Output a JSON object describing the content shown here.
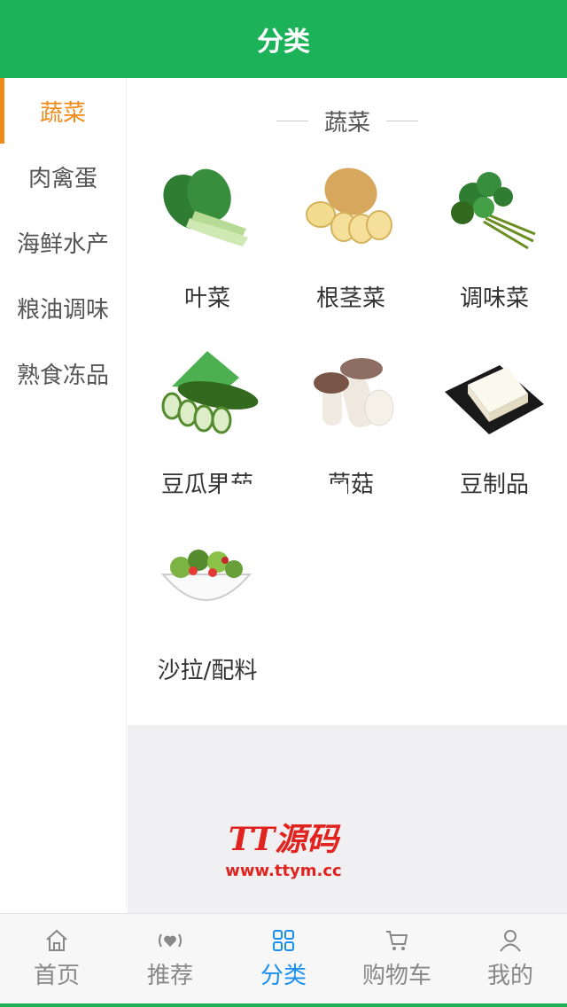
{
  "header": {
    "title": "分类"
  },
  "sidebar": {
    "items": [
      {
        "label": "蔬菜",
        "active": true
      },
      {
        "label": "肉禽蛋",
        "active": false
      },
      {
        "label": "海鲜水产",
        "active": false
      },
      {
        "label": "粮油调味",
        "active": false
      },
      {
        "label": "熟食冻品",
        "active": false
      }
    ]
  },
  "section": {
    "title": "蔬菜"
  },
  "categories": [
    {
      "label": "叶菜",
      "icon": "bok-choy-icon"
    },
    {
      "label": "根茎菜",
      "icon": "potato-icon"
    },
    {
      "label": "调味菜",
      "icon": "parsley-icon"
    },
    {
      "label": "豆瓜果茄",
      "icon": "cucumber-icon"
    },
    {
      "label": "菌菇",
      "icon": "mushroom-icon"
    },
    {
      "label": "豆制品",
      "icon": "tofu-icon"
    },
    {
      "label": "沙拉/配料",
      "icon": "salad-icon"
    }
  ],
  "watermark": {
    "title": "TT源码",
    "url": "www.ttym.cc"
  },
  "tabbar": [
    {
      "label": "首页",
      "icon": "home-icon",
      "active": false
    },
    {
      "label": "推荐",
      "icon": "heart-signal-icon",
      "active": false
    },
    {
      "label": "分类",
      "icon": "grid-icon",
      "active": true
    },
    {
      "label": "购物车",
      "icon": "cart-icon",
      "active": false
    },
    {
      "label": "我的",
      "icon": "user-icon",
      "active": false
    }
  ],
  "colors": {
    "brand": "#1bb25a",
    "sidebar_active": "#f08a1a",
    "tab_active": "#1a8ff0"
  }
}
